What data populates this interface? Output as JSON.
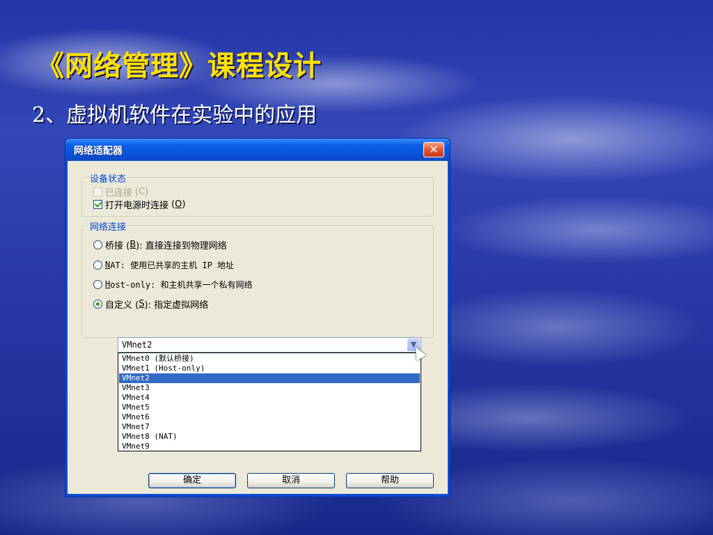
{
  "slide": {
    "title": "《网络管理》课程设计",
    "subtitle": "2、虚拟机软件在实验中的应用"
  },
  "dialog": {
    "title": "网络适配器",
    "close_icon": "close-icon",
    "device_status": {
      "legend": "设备状态",
      "connected": {
        "label": "已连接",
        "accel": "(C)",
        "checked": false,
        "enabled": false
      },
      "connect_at_power_on": {
        "label": "打开电源时连接",
        "accel_open": "(",
        "accel_key": "O",
        "accel_close": ")",
        "checked": true
      }
    },
    "network_connection": {
      "legend": "网络连接",
      "options": [
        {
          "pre": "桥接 (",
          "key": "B",
          "post": "): 直接连接到物理网络",
          "checked": false
        },
        {
          "pre": "",
          "key": "N",
          "post": "AT: 使用已共享的主机 IP 地址",
          "checked": false
        },
        {
          "pre": "",
          "key": "H",
          "post": "ost-only: 和主机共享一个私有网络",
          "checked": false
        },
        {
          "pre": "自定义 (",
          "key": "S",
          "post": "): 指定虚拟网络",
          "checked": true
        }
      ],
      "combo": {
        "value": "VMnet2",
        "items": [
          "VMnet0 (默认桥接)",
          "VMnet1 (Host-only)",
          "VMnet2",
          "VMnet3",
          "VMnet4",
          "VMnet5",
          "VMnet6",
          "VMnet7",
          "VMnet8 (NAT)",
          "VMnet9"
        ],
        "selected": "VMnet2"
      }
    },
    "buttons": {
      "ok": "确定",
      "cancel": "取消",
      "help": "帮助"
    }
  },
  "colors": {
    "title_yellow": "#ffe100",
    "xp_blue": "#0a53d8",
    "group_legend_blue": "#0046d5",
    "selection_blue": "#316ac5"
  }
}
